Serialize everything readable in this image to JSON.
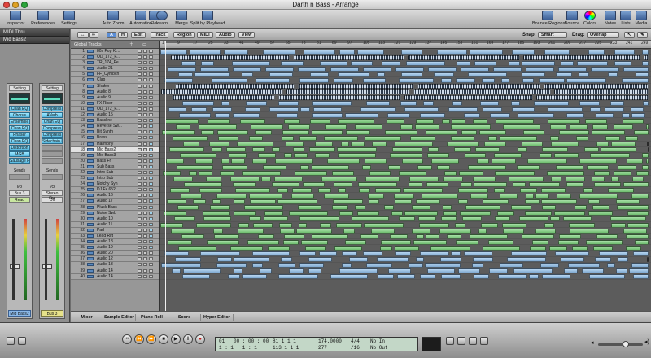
{
  "window": {
    "title": "Darth n Bass - Arrange"
  },
  "toolbar": {
    "left_items": [
      "Inspector",
      "Preferences",
      "Settings",
      "Auto Zoom",
      "Automation",
      "Flex",
      "Learn",
      "Merge",
      "Split by Playhead"
    ],
    "right_items": [
      "Bounce Regions",
      "Bounce",
      "Colors",
      "Notes",
      "Lists",
      "Media"
    ]
  },
  "inspector": {
    "regions": [
      "MIDI Thru",
      "Mid Bass2"
    ],
    "strip_left": {
      "setting": "Setting",
      "inserts": [
        "Chan EQ",
        "Chorus",
        "Ensemble",
        "Chan EQ",
        "Phaser",
        "Chan EQ",
        "Distortion",
        "MGB",
        "Sausage Fa"
      ],
      "sends": "Sends",
      "io": "I/O",
      "output": "Bus 3",
      "automation": "Read",
      "name": "Mid Bass2"
    },
    "strip_right": {
      "setting": "Setting",
      "inserts": [
        "Compress",
        "AVerb",
        "Chan EQ",
        "Compress",
        "Compress",
        "Sidechain Bus"
      ],
      "sends": "Sends",
      "io": "I/O",
      "output": "Stereo Out",
      "automation": "Off",
      "name": "Bus 3"
    }
  },
  "arrange": {
    "menus": [
      "Edit",
      "Track",
      "Region",
      "MIDI",
      "Audio",
      "View"
    ],
    "snap_label": "Snap:",
    "snap_value": "Smart",
    "drag_label": "Drag:",
    "drag_value": "Overlap",
    "global_tracks": "Global Tracks",
    "ruler": [
      "1",
      "9",
      "17",
      "25",
      "33",
      "41",
      "49",
      "57",
      "65",
      "73",
      "81",
      "89",
      "97",
      "105",
      "113",
      "121",
      "129",
      "137",
      "145",
      "153",
      "161",
      "169",
      "177",
      "185",
      "193",
      "201",
      "209",
      "217",
      "225",
      "233",
      "241",
      "249"
    ],
    "tracks": [
      {
        "num": "1",
        "name": "80s Pop Ki..."
      },
      {
        "num": "2",
        "name": "OD_172_F..."
      },
      {
        "num": "3",
        "name": "TR_174_Pe..."
      },
      {
        "num": "4",
        "name": "Audio 21"
      },
      {
        "num": "5",
        "name": "FF_Cymbch"
      },
      {
        "num": "6",
        "name": "Clap"
      },
      {
        "num": "7",
        "name": "Shaker"
      },
      {
        "num": "8",
        "name": "Audio 8"
      },
      {
        "num": "9",
        "name": "Audio 9"
      },
      {
        "num": "10",
        "name": "FX Riser"
      },
      {
        "num": "11",
        "name": "OD_172_F..."
      },
      {
        "num": "12",
        "name": "Audio 15"
      },
      {
        "num": "13",
        "name": "Bassline"
      },
      {
        "num": "14",
        "name": "Reverse Sw..."
      },
      {
        "num": "15",
        "name": "Bit Synth"
      },
      {
        "num": "16",
        "name": "Brass"
      },
      {
        "num": "17",
        "name": "Harmony"
      },
      {
        "num": "18",
        "name": "Mid Bass2"
      },
      {
        "num": "19",
        "name": "Mid Bass3"
      },
      {
        "num": "20",
        "name": "Bass Fr"
      },
      {
        "num": "21",
        "name": "Sub Bass"
      },
      {
        "num": "22",
        "name": "Intro Sub"
      },
      {
        "num": "23",
        "name": "Intro Sub"
      },
      {
        "num": "24",
        "name": "Notchy Syn"
      },
      {
        "num": "25",
        "name": "DJ Fx 652"
      },
      {
        "num": "26",
        "name": "Audio 16"
      },
      {
        "num": "27",
        "name": "Audio 17"
      },
      {
        "num": "28",
        "name": "Pluck Bass"
      },
      {
        "num": "29",
        "name": "Noise Swb"
      },
      {
        "num": "30",
        "name": "Audio 10"
      },
      {
        "num": "31",
        "name": "Audio 11"
      },
      {
        "num": "32",
        "name": "Pad"
      },
      {
        "num": "33",
        "name": "Lead Rift"
      },
      {
        "num": "34",
        "name": "Audio 18"
      },
      {
        "num": "35",
        "name": "Audio 19"
      },
      {
        "num": "36",
        "name": "Audio 20"
      },
      {
        "num": "37",
        "name": "Audio 12"
      },
      {
        "num": "38",
        "name": "Audio 13"
      },
      {
        "num": "39",
        "name": "Audio 14"
      },
      {
        "num": "40",
        "name": "Audio 14"
      }
    ],
    "bottom_tabs": [
      "Mixer",
      "Sample Editor",
      "Piano Roll",
      "Score",
      "Hyper Editor"
    ]
  },
  "transport": {
    "smpte": "01 : 00 : 00 : 00",
    "smpte_sub": "1 : 1 : 1 : 1",
    "bars": "81  1  1  1",
    "bars_sub": "113  1  1  1",
    "tempo": "174.0000",
    "signature": "4/4",
    "division": "/16",
    "position2": "277",
    "midi_in": "No In",
    "midi_out": "No Out"
  }
}
